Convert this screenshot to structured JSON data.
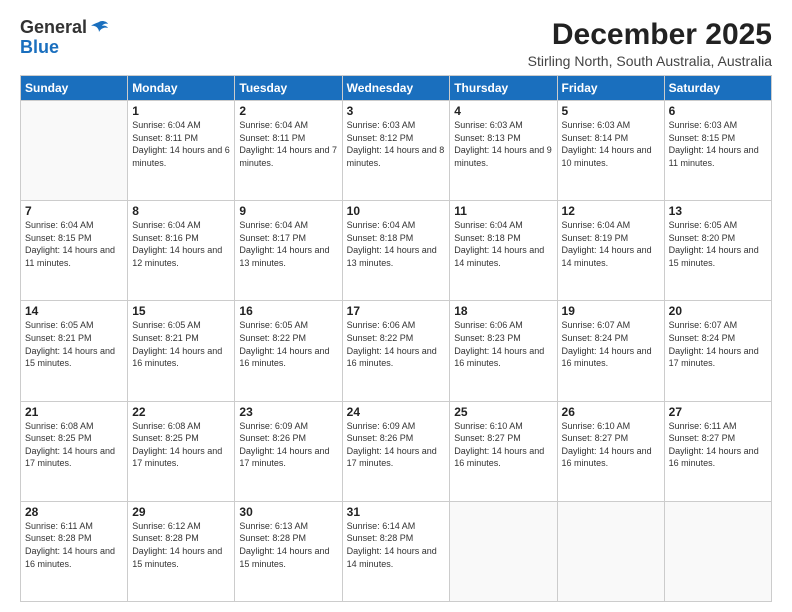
{
  "logo": {
    "general": "General",
    "blue": "Blue"
  },
  "title": "December 2025",
  "location": "Stirling North, South Australia, Australia",
  "weekdays": [
    "Sunday",
    "Monday",
    "Tuesday",
    "Wednesday",
    "Thursday",
    "Friday",
    "Saturday"
  ],
  "weeks": [
    [
      {
        "day": "",
        "sunrise": "",
        "sunset": "",
        "daylight": ""
      },
      {
        "day": "1",
        "sunrise": "Sunrise: 6:04 AM",
        "sunset": "Sunset: 8:11 PM",
        "daylight": "Daylight: 14 hours and 6 minutes."
      },
      {
        "day": "2",
        "sunrise": "Sunrise: 6:04 AM",
        "sunset": "Sunset: 8:11 PM",
        "daylight": "Daylight: 14 hours and 7 minutes."
      },
      {
        "day": "3",
        "sunrise": "Sunrise: 6:03 AM",
        "sunset": "Sunset: 8:12 PM",
        "daylight": "Daylight: 14 hours and 8 minutes."
      },
      {
        "day": "4",
        "sunrise": "Sunrise: 6:03 AM",
        "sunset": "Sunset: 8:13 PM",
        "daylight": "Daylight: 14 hours and 9 minutes."
      },
      {
        "day": "5",
        "sunrise": "Sunrise: 6:03 AM",
        "sunset": "Sunset: 8:14 PM",
        "daylight": "Daylight: 14 hours and 10 minutes."
      },
      {
        "day": "6",
        "sunrise": "Sunrise: 6:03 AM",
        "sunset": "Sunset: 8:15 PM",
        "daylight": "Daylight: 14 hours and 11 minutes."
      }
    ],
    [
      {
        "day": "7",
        "sunrise": "Sunrise: 6:04 AM",
        "sunset": "Sunset: 8:15 PM",
        "daylight": "Daylight: 14 hours and 11 minutes."
      },
      {
        "day": "8",
        "sunrise": "Sunrise: 6:04 AM",
        "sunset": "Sunset: 8:16 PM",
        "daylight": "Daylight: 14 hours and 12 minutes."
      },
      {
        "day": "9",
        "sunrise": "Sunrise: 6:04 AM",
        "sunset": "Sunset: 8:17 PM",
        "daylight": "Daylight: 14 hours and 13 minutes."
      },
      {
        "day": "10",
        "sunrise": "Sunrise: 6:04 AM",
        "sunset": "Sunset: 8:18 PM",
        "daylight": "Daylight: 14 hours and 13 minutes."
      },
      {
        "day": "11",
        "sunrise": "Sunrise: 6:04 AM",
        "sunset": "Sunset: 8:18 PM",
        "daylight": "Daylight: 14 hours and 14 minutes."
      },
      {
        "day": "12",
        "sunrise": "Sunrise: 6:04 AM",
        "sunset": "Sunset: 8:19 PM",
        "daylight": "Daylight: 14 hours and 14 minutes."
      },
      {
        "day": "13",
        "sunrise": "Sunrise: 6:05 AM",
        "sunset": "Sunset: 8:20 PM",
        "daylight": "Daylight: 14 hours and 15 minutes."
      }
    ],
    [
      {
        "day": "14",
        "sunrise": "Sunrise: 6:05 AM",
        "sunset": "Sunset: 8:21 PM",
        "daylight": "Daylight: 14 hours and 15 minutes."
      },
      {
        "day": "15",
        "sunrise": "Sunrise: 6:05 AM",
        "sunset": "Sunset: 8:21 PM",
        "daylight": "Daylight: 14 hours and 16 minutes."
      },
      {
        "day": "16",
        "sunrise": "Sunrise: 6:05 AM",
        "sunset": "Sunset: 8:22 PM",
        "daylight": "Daylight: 14 hours and 16 minutes."
      },
      {
        "day": "17",
        "sunrise": "Sunrise: 6:06 AM",
        "sunset": "Sunset: 8:22 PM",
        "daylight": "Daylight: 14 hours and 16 minutes."
      },
      {
        "day": "18",
        "sunrise": "Sunrise: 6:06 AM",
        "sunset": "Sunset: 8:23 PM",
        "daylight": "Daylight: 14 hours and 16 minutes."
      },
      {
        "day": "19",
        "sunrise": "Sunrise: 6:07 AM",
        "sunset": "Sunset: 8:24 PM",
        "daylight": "Daylight: 14 hours and 16 minutes."
      },
      {
        "day": "20",
        "sunrise": "Sunrise: 6:07 AM",
        "sunset": "Sunset: 8:24 PM",
        "daylight": "Daylight: 14 hours and 17 minutes."
      }
    ],
    [
      {
        "day": "21",
        "sunrise": "Sunrise: 6:08 AM",
        "sunset": "Sunset: 8:25 PM",
        "daylight": "Daylight: 14 hours and 17 minutes."
      },
      {
        "day": "22",
        "sunrise": "Sunrise: 6:08 AM",
        "sunset": "Sunset: 8:25 PM",
        "daylight": "Daylight: 14 hours and 17 minutes."
      },
      {
        "day": "23",
        "sunrise": "Sunrise: 6:09 AM",
        "sunset": "Sunset: 8:26 PM",
        "daylight": "Daylight: 14 hours and 17 minutes."
      },
      {
        "day": "24",
        "sunrise": "Sunrise: 6:09 AM",
        "sunset": "Sunset: 8:26 PM",
        "daylight": "Daylight: 14 hours and 17 minutes."
      },
      {
        "day": "25",
        "sunrise": "Sunrise: 6:10 AM",
        "sunset": "Sunset: 8:27 PM",
        "daylight": "Daylight: 14 hours and 16 minutes."
      },
      {
        "day": "26",
        "sunrise": "Sunrise: 6:10 AM",
        "sunset": "Sunset: 8:27 PM",
        "daylight": "Daylight: 14 hours and 16 minutes."
      },
      {
        "day": "27",
        "sunrise": "Sunrise: 6:11 AM",
        "sunset": "Sunset: 8:27 PM",
        "daylight": "Daylight: 14 hours and 16 minutes."
      }
    ],
    [
      {
        "day": "28",
        "sunrise": "Sunrise: 6:11 AM",
        "sunset": "Sunset: 8:28 PM",
        "daylight": "Daylight: 14 hours and 16 minutes."
      },
      {
        "day": "29",
        "sunrise": "Sunrise: 6:12 AM",
        "sunset": "Sunset: 8:28 PM",
        "daylight": "Daylight: 14 hours and 15 minutes."
      },
      {
        "day": "30",
        "sunrise": "Sunrise: 6:13 AM",
        "sunset": "Sunset: 8:28 PM",
        "daylight": "Daylight: 14 hours and 15 minutes."
      },
      {
        "day": "31",
        "sunrise": "Sunrise: 6:14 AM",
        "sunset": "Sunset: 8:28 PM",
        "daylight": "Daylight: 14 hours and 14 minutes."
      },
      {
        "day": "",
        "sunrise": "",
        "sunset": "",
        "daylight": ""
      },
      {
        "day": "",
        "sunrise": "",
        "sunset": "",
        "daylight": ""
      },
      {
        "day": "",
        "sunrise": "",
        "sunset": "",
        "daylight": ""
      }
    ]
  ]
}
